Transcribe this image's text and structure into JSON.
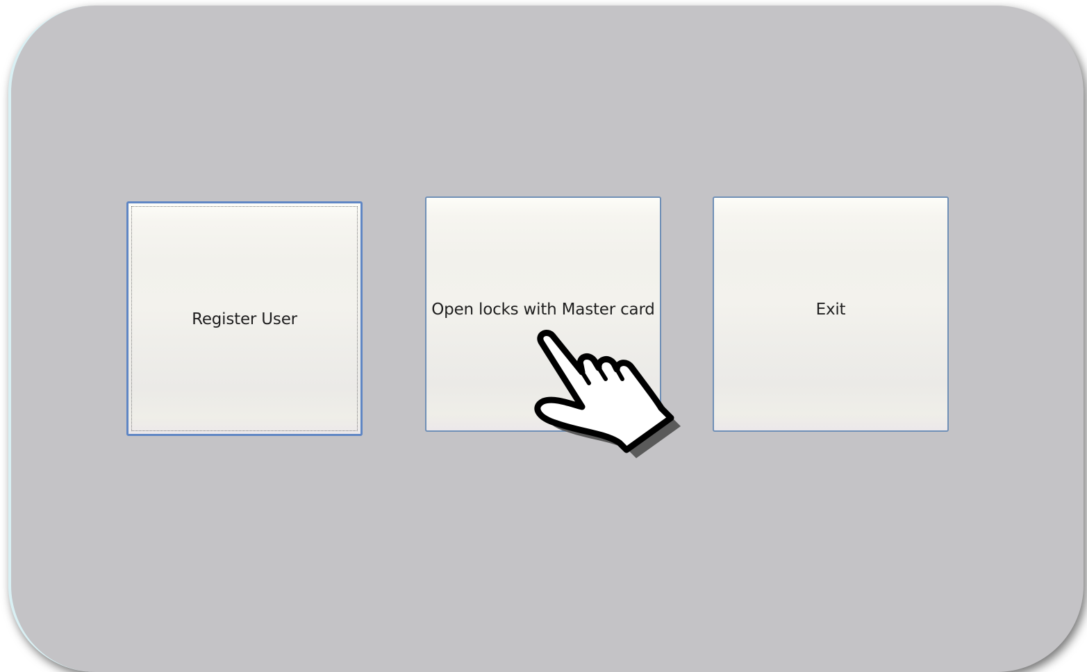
{
  "buttons": {
    "register_user": "Register User",
    "open_locks": "Open locks with Master card",
    "exit": "Exit"
  },
  "colors": {
    "panel_background": "#c4c3c6",
    "button_border": "#6f8fb6",
    "focused_border": "#5f86c4"
  },
  "cursor": {
    "icon": "hand-pointer-icon"
  }
}
